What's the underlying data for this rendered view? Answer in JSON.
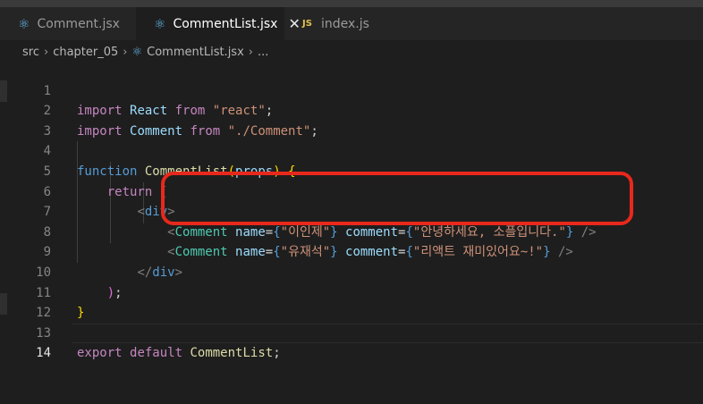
{
  "tabs": [
    {
      "label": "Comment.jsx",
      "icon": "react-icon",
      "active": false
    },
    {
      "label": "CommentList.jsx",
      "icon": "react-icon",
      "active": true
    },
    {
      "label": "index.js",
      "icon": "js-icon",
      "active": false
    }
  ],
  "js_icon_text": "JS",
  "breadcrumb": {
    "items": [
      "src",
      "chapter_05",
      "CommentList.jsx",
      "..."
    ]
  },
  "editor": {
    "line_numbers": [
      "1",
      "2",
      "3",
      "4",
      "5",
      "6",
      "7",
      "8",
      "9",
      "10",
      "11",
      "12",
      "13",
      "14"
    ],
    "current_line": 14,
    "tokens": {
      "import": "import",
      "from": "from",
      "React": "React",
      "react_str": "\"react\"",
      "Comment": "Comment",
      "comment_path": "\"./Comment\"",
      "semi": ";",
      "function": "function",
      "CommentList": "CommentList",
      "props": "props",
      "return": "return",
      "div": "div",
      "name_attr": "name",
      "comment_attr": "comment",
      "name1": "\"이인제\"",
      "comment1": "\"안녕하세요, 소플입니다.\"",
      "name2": "\"유재석\"",
      "comment2": "\"리액트 재미있어요~!\"",
      "export": "export",
      "default": "default"
    }
  },
  "annotation_color": "#e8281c"
}
